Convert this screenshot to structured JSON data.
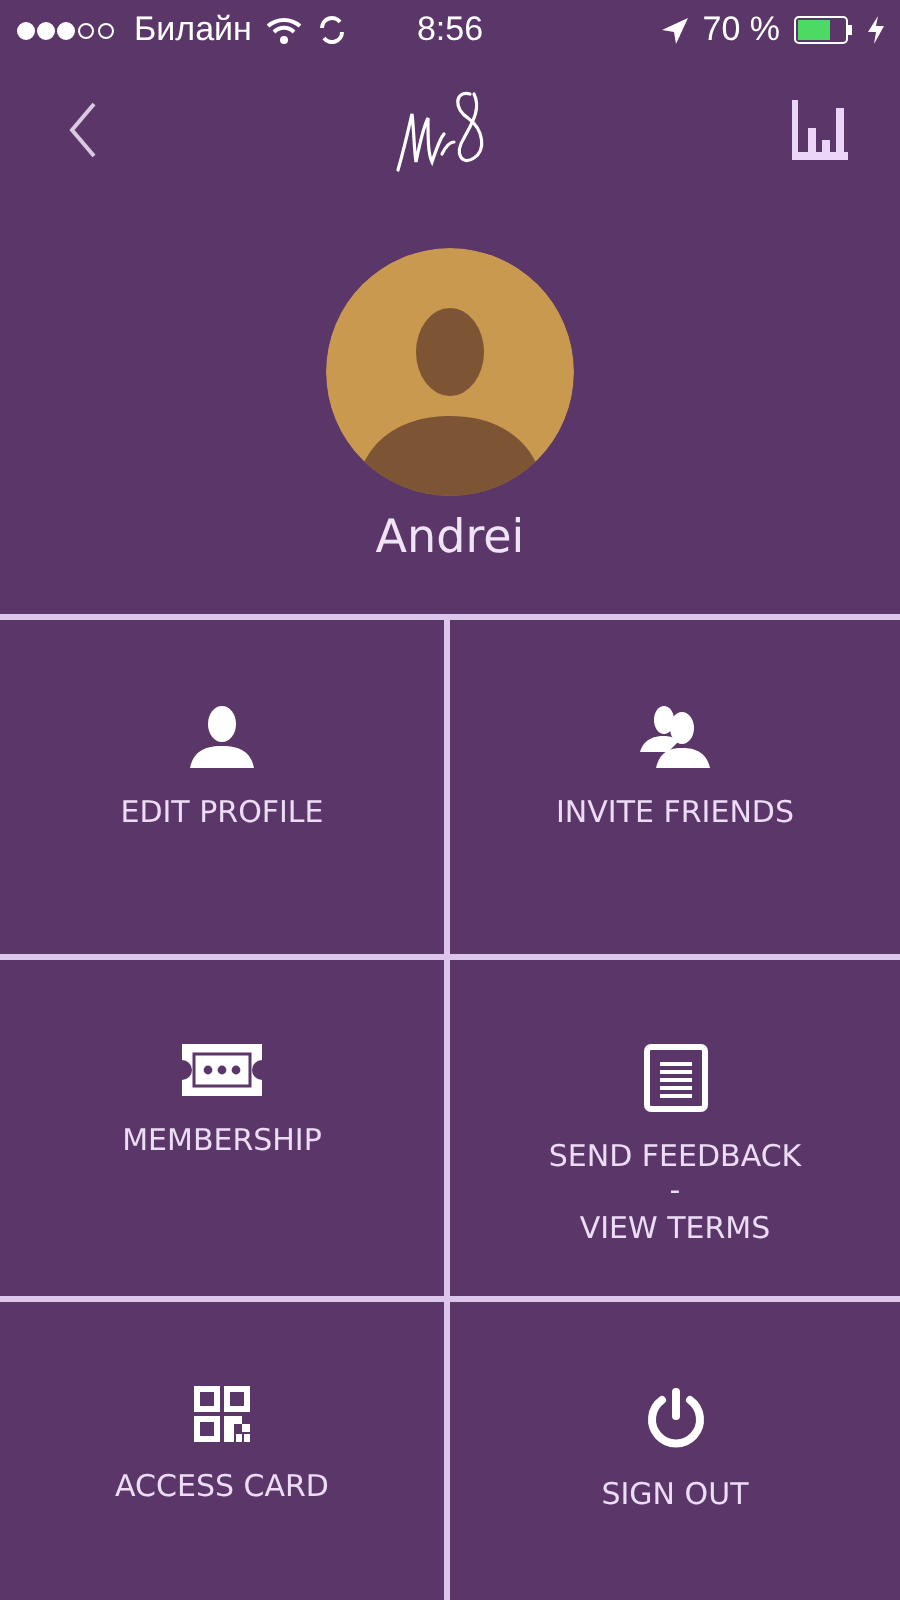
{
  "status_bar": {
    "carrier": "Билайн",
    "time": "8:56",
    "battery": "70 %"
  },
  "profile": {
    "name": "Andrei"
  },
  "menu": [
    {
      "kind": "profile",
      "label": "EDIT PROFILE"
    },
    {
      "kind": "friends",
      "label": "INVITE FRIENDS"
    },
    {
      "kind": "ticket",
      "label": "MEMBERSHIP"
    },
    {
      "kind": "document",
      "label": "SEND FEEDBACK",
      "separator": "-",
      "sublabel": "VIEW TERMS"
    },
    {
      "kind": "qr",
      "label": "ACCESS CARD"
    },
    {
      "kind": "power",
      "label": "SIGN OUT"
    }
  ]
}
